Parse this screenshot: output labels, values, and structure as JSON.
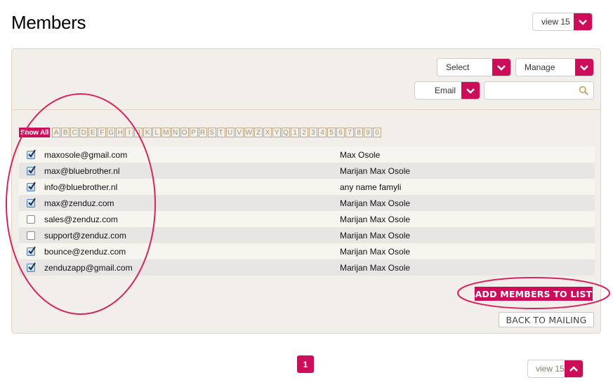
{
  "page": {
    "title": "Members"
  },
  "view_top": {
    "label": "view 15",
    "icon": "chevron-down-icon"
  },
  "toolbar": {
    "select": {
      "label": "Select",
      "icon": "chevron-down-icon"
    },
    "manage": {
      "label": "Manage",
      "icon": "chevron-down-icon"
    },
    "email": {
      "label": "Email",
      "icon": "chevron-down-icon"
    },
    "search": {
      "value": "",
      "placeholder": "",
      "icon": "search-icon"
    }
  },
  "alpha_filter": {
    "show_all": "Show All",
    "letters": [
      "A",
      "B",
      "C",
      "D",
      "E",
      "F",
      "G",
      "H",
      "I",
      "J",
      "K",
      "L",
      "M",
      "N",
      "O",
      "P",
      "R",
      "S",
      "T",
      "U",
      "V",
      "W",
      "Z",
      "X",
      "Y",
      "Q",
      "1",
      "2",
      "3",
      "4",
      "5",
      "6",
      "7",
      "8",
      "9",
      "0"
    ]
  },
  "members": [
    {
      "checked": true,
      "email": "maxosole@gmail.com",
      "name": "Max Osole"
    },
    {
      "checked": true,
      "email": "max@bluebrother.nl",
      "name": "Marijan Max Osole"
    },
    {
      "checked": true,
      "email": "info@bluebrother.nl",
      "name": "any name famyli"
    },
    {
      "checked": true,
      "email": "max@zenduz.com",
      "name": "Marijan Max Osole"
    },
    {
      "checked": false,
      "email": "sales@zenduz.com",
      "name": "Marijan Max Osole"
    },
    {
      "checked": false,
      "email": "support@zenduz.com",
      "name": "Marijan Max Osole"
    },
    {
      "checked": true,
      "email": "bounce@zenduz.com",
      "name": "Marijan Max Osole"
    },
    {
      "checked": true,
      "email": "zenduzapp@gmail.com",
      "name": "Marijan Max Osole"
    }
  ],
  "actions": {
    "add_members": "ADD MEMBERS TO LIST",
    "back_to_mailing": "BACK TO MAILING"
  },
  "pagination": {
    "current_page": "1",
    "view_bottom": {
      "label": "view 15",
      "icon": "chevron-up-icon"
    }
  },
  "colors": {
    "accent": "#cc0d5a",
    "annotation": "#d6245e",
    "panel_bg": "#f2efea",
    "row_odd": "#f6f5ee",
    "row_even": "#e7e6e4"
  }
}
